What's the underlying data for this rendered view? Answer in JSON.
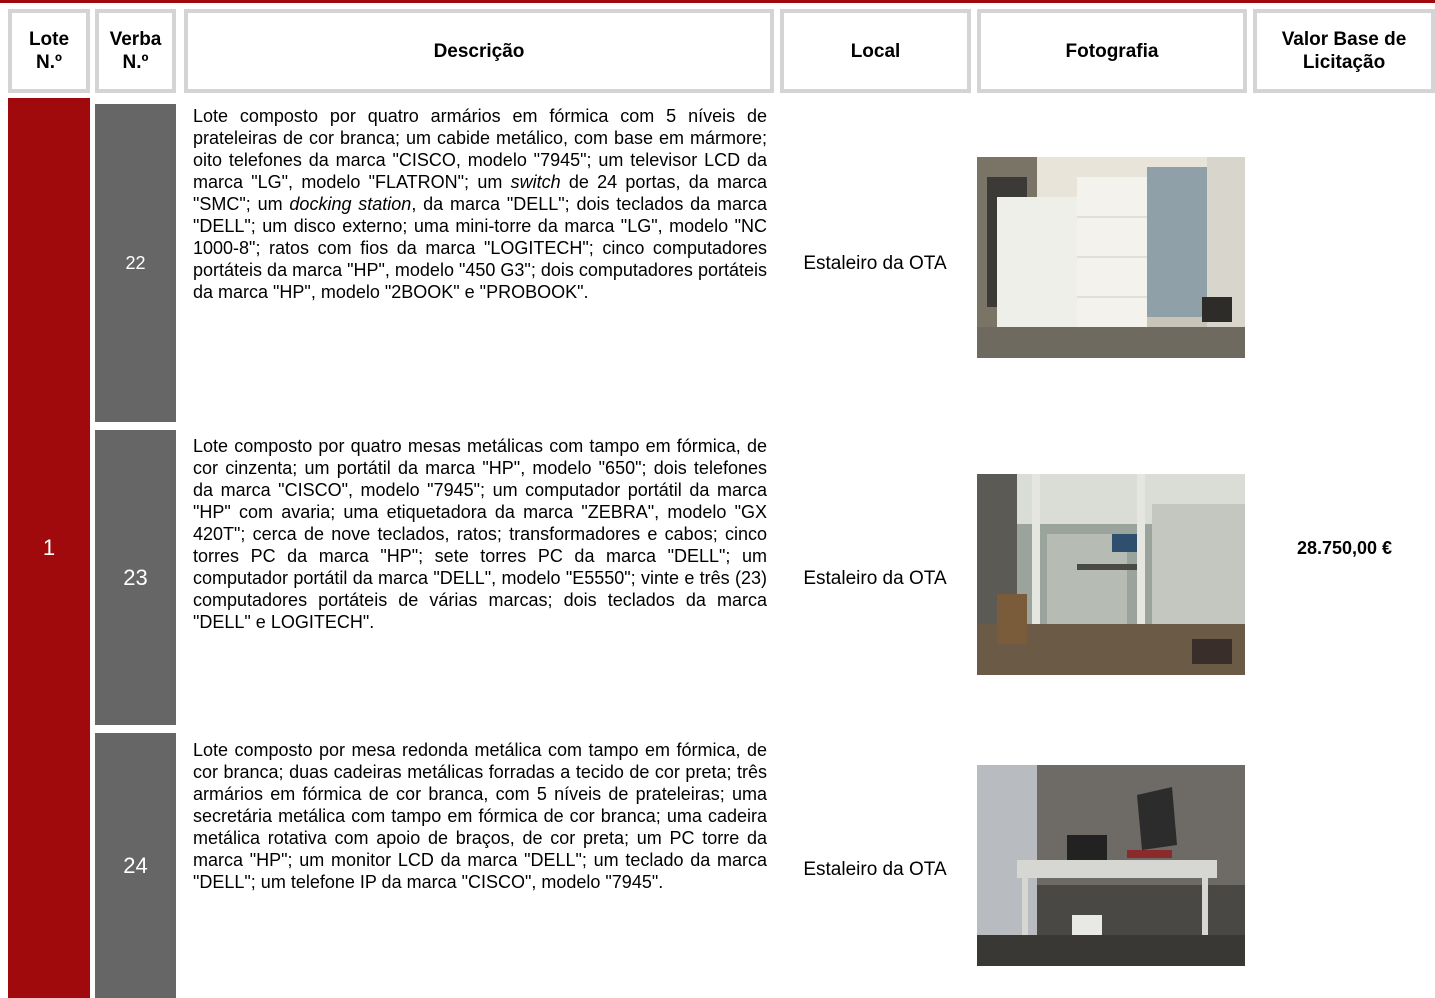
{
  "header": {
    "lote": "Lote\nN.º",
    "verba": "Verba\nN.º",
    "descricao": "Descrição",
    "local": "Local",
    "fotografia": "Fotografia",
    "valor": "Valor Base de\nLicitação"
  },
  "lote": {
    "number": "1",
    "valor_base": "28.750,00 €",
    "verbas": [
      {
        "number": "22",
        "description_parts": [
          "Lote composto por quatro armários em fórmica com 5 níveis de prateleiras de cor branca; um cabide metálico, com base em mármore; oito telefones da marca \"CISCO, modelo \"7945\"; um televisor LCD da marca \"LG\", modelo \"FLATRON\"; um ",
          "switch",
          " de 24 portas, da marca \"SMC\"; um ",
          "docking station",
          ", da marca \"DELL\"; dois teclados da marca \"DELL\"; um disco externo; uma mini-torre da marca \"LG\", modelo \"NC 1000-8\"; ratos com fios da marca \"LOGITECH\"; cinco computadores portáteis da marca \"HP\", modelo \"450 G3\"; dois computadores portáteis da marca \"HP\", modelo \"2BOOK\" e \"PROBOOK\"."
        ],
        "local": "Estaleiro da OTA",
        "photo": "office-cabinets-photo"
      },
      {
        "number": "23",
        "description": "Lote composto por quatro mesas metálicas com tampo em fórmica, de cor cinzenta; um portátil da marca \"HP\", modelo \"650\"; dois telefones da marca \"CISCO\", modelo \"7945\"; um computador portátil da marca \"HP\" com avaria; uma etiquetadora da marca \"ZEBRA\", modelo \"GX 420T\"; cerca de nove teclados, ratos; transformadores e cabos; cinco torres PC da marca \"HP\"; sete torres PC da marca \"DELL\"; um computador portátil da marca \"DELL\", modelo \"E5550\"; vinte e três (23) computadores portáteis de várias marcas; dois teclados da marca \"DELL\" e LOGITECH\".",
        "local": "Estaleiro da OTA",
        "photo": "glass-office-photo"
      },
      {
        "number": "24",
        "description": "Lote composto por mesa redonda metálica com tampo em fórmica, de cor branca; duas cadeiras metálicas forradas a tecido de cor preta; três armários em fórmica de cor branca, com 5 níveis de prateleiras; uma secretária metálica com tampo em fórmica de cor branca; uma cadeira metálica rotativa com apoio de braços, de cor preta; um PC torre da marca \"HP\"; um monitor LCD da marca \"DELL\"; um teclado da marca \"DELL\"; um telefone IP da marca \"CISCO\", modelo \"7945\".",
        "local": "Estaleiro da OTA",
        "photo": "desk-corner-photo"
      }
    ]
  },
  "colors": {
    "accent": "#a10a0d",
    "verba_bg": "#666666",
    "header_border": "#d4d4d4"
  }
}
